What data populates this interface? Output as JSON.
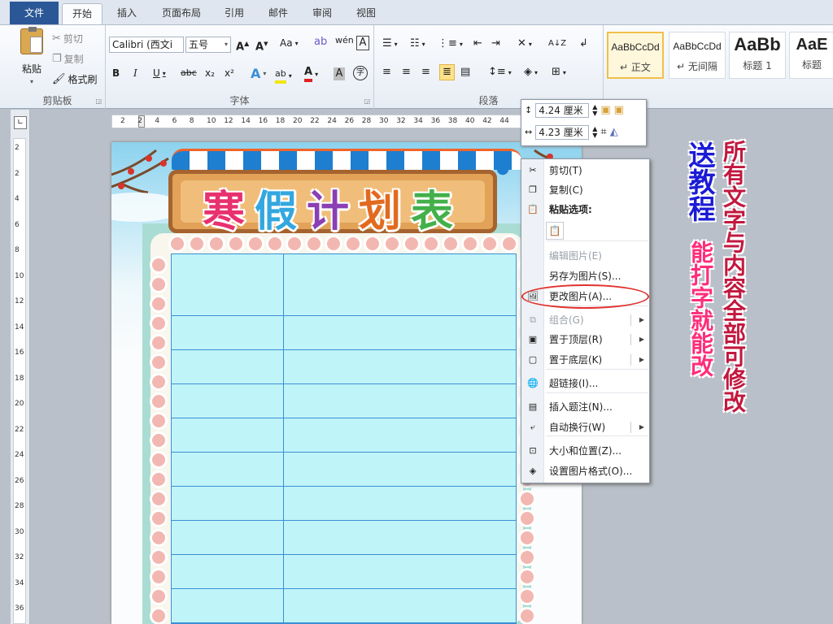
{
  "tabs": {
    "file": "文件",
    "home": "开始",
    "insert": "插入",
    "layout": "页面布局",
    "references": "引用",
    "mailings": "邮件",
    "review": "审阅",
    "view": "视图"
  },
  "clipboard": {
    "paste": "粘贴",
    "cut": "剪切",
    "copy": "复制",
    "format_painter": "格式刷",
    "group_label": "剪贴板"
  },
  "font": {
    "font_name": "Calibri (西文i",
    "font_size": "五号",
    "group_label": "字体",
    "format_letters": {
      "aa": "Aa",
      "b": "B",
      "i": "I",
      "u": "U",
      "abc": "abc",
      "sub": "x₂",
      "sup": "x²",
      "a": "A"
    }
  },
  "paragraph": {
    "group_label": "段落"
  },
  "styles": [
    {
      "preview": "AaBbCcDd",
      "name": "正文"
    },
    {
      "preview": "AaBbCcDd",
      "name": "无间隔"
    },
    {
      "preview": "AaBb",
      "name": "标题 1"
    },
    {
      "preview": "AaE",
      "name": "标题"
    }
  ],
  "ruler": {
    "h_numbers": [
      "2",
      "2",
      "4",
      "6",
      "8",
      "10",
      "12",
      "14",
      "16",
      "18",
      "20",
      "22",
      "24",
      "26",
      "28",
      "30",
      "32",
      "34",
      "36",
      "38",
      "40",
      "42",
      "44"
    ],
    "v_numbers": [
      "2",
      "2",
      "4",
      "6",
      "8",
      "10",
      "12",
      "14",
      "16",
      "18",
      "20",
      "22",
      "24",
      "26",
      "28",
      "30",
      "32",
      "34",
      "36"
    ]
  },
  "size_box": {
    "height": "4.24 厘米",
    "width": "4.23 厘米"
  },
  "poster": {
    "title": [
      "寒",
      "假",
      "计",
      "划",
      "表"
    ],
    "title_colors": [
      "#e8316f",
      "#33a7df",
      "#8a3fb3",
      "#e26a1f",
      "#43b04a"
    ]
  },
  "context_menu": [
    {
      "label": "剪切(T)",
      "icon": "scissors-icon",
      "disabled": false,
      "submenu": false
    },
    {
      "label": "复制(C)",
      "icon": "copy-icon",
      "disabled": false,
      "submenu": false
    },
    {
      "label": "粘贴选项:",
      "icon": "paste-icon",
      "disabled": false,
      "submenu": false,
      "bold": true
    },
    {
      "label": "编辑图片(E)",
      "icon": "",
      "disabled": true,
      "submenu": false
    },
    {
      "label": "另存为图片(S)...",
      "icon": "",
      "disabled": false,
      "submenu": false
    },
    {
      "label": "更改图片(A)...",
      "icon": "change-picture-icon",
      "disabled": false,
      "submenu": false
    },
    {
      "label": "组合(G)",
      "icon": "group-icon",
      "disabled": true,
      "submenu": true
    },
    {
      "label": "置于顶层(R)",
      "icon": "bring-front-icon",
      "disabled": false,
      "submenu": true
    },
    {
      "label": "置于底层(K)",
      "icon": "send-back-icon",
      "disabled": false,
      "submenu": true
    },
    {
      "label": "超链接(I)...",
      "icon": "hyperlink-icon",
      "disabled": false,
      "submenu": false
    },
    {
      "label": "插入题注(N)...",
      "icon": "caption-icon",
      "disabled": false,
      "submenu": false
    },
    {
      "label": "自动换行(W)",
      "icon": "wrap-icon",
      "disabled": false,
      "submenu": true
    },
    {
      "label": "大小和位置(Z)...",
      "icon": "size-icon",
      "disabled": false,
      "submenu": false
    },
    {
      "label": "设置图片格式(O)...",
      "icon": "format-picture-icon",
      "disabled": false,
      "submenu": false
    }
  ],
  "promo": {
    "col1": "送教程",
    "col2": "所有文字与内容全部可修改",
    "col3": "能打字就能改"
  },
  "colors": {
    "accent": "#2b5797",
    "highlight": "#e0322e",
    "promo_blue": "#1b1bd6",
    "promo_red": "#c2183f",
    "promo_pink": "#ff2d7a"
  }
}
